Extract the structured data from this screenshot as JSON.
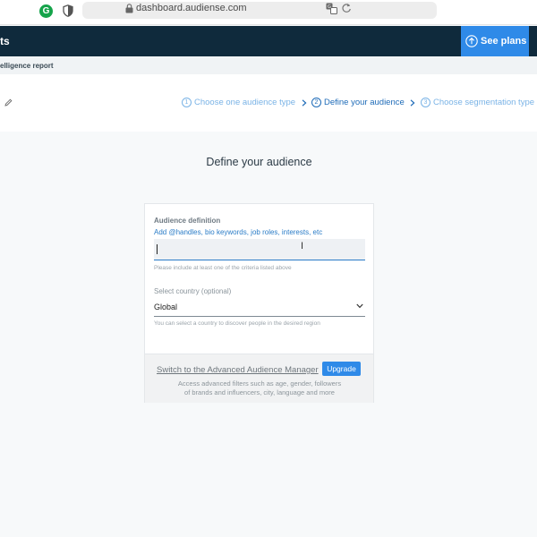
{
  "browser": {
    "url": "dashboard.audiense.com",
    "extension_letter": "G",
    "icons": [
      "grammarly-icon",
      "shield-icon",
      "lock-icon",
      "translate-icon",
      "reload-icon"
    ]
  },
  "topbar": {
    "title_fragment": "ts",
    "see_plans_label": "See plans",
    "colors": {
      "bar": "#0f2a3c",
      "accent": "#2f8ae8"
    }
  },
  "subheader": {
    "text": "elligence report"
  },
  "steps": [
    {
      "number": "1",
      "label": "Choose one audience type",
      "state": "inactive"
    },
    {
      "number": "2",
      "label": "Define your audience",
      "state": "active"
    },
    {
      "number": "3",
      "label": "Choose segmentation type",
      "state": "inactive"
    }
  ],
  "page": {
    "heading": "Define your audience"
  },
  "form": {
    "audience_definition_label": "Audience definition",
    "audience_definition_hint": "Add @handles, bio keywords, job roles, interests, etc",
    "audience_definition_value": "",
    "audience_definition_helper": "Please include at least one of the criteria listed above",
    "country_label": "Select country (optional)",
    "country_value": "Global",
    "country_helper": "You can select a country to discover people in the desired region"
  },
  "footer": {
    "advanced_link": "Switch to the Advanced Audience Manager",
    "upgrade_label": "Upgrade",
    "description_line1": "Access advanced filters such as age, gender, followers",
    "description_line2": "of brands and influencers, city, language and more"
  }
}
